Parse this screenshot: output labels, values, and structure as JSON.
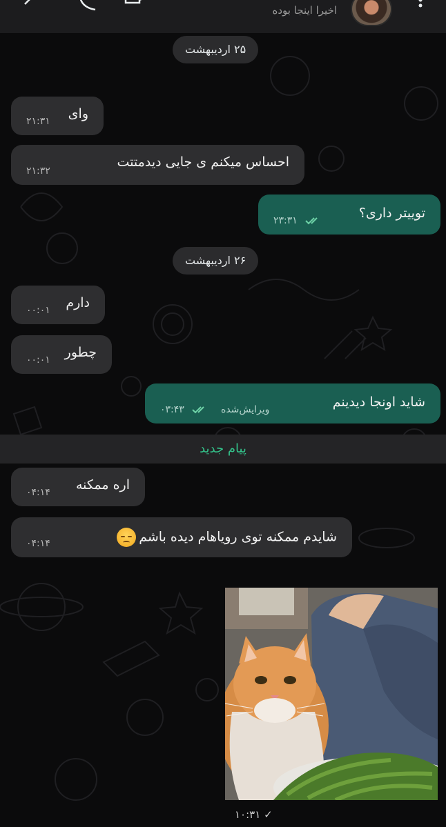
{
  "header": {
    "status": "اخیرا اینجا بوده"
  },
  "dates": [
    {
      "label": "۲۵ اردیبهشت"
    },
    {
      "label": "۲۶ اردیبهشت"
    }
  ],
  "messages": [
    {
      "text": "وای",
      "time": "۲۱:۳۱"
    },
    {
      "text": "احساس میکنم ی جایی دیدمتتت",
      "time": "۲۱:۳۲"
    },
    {
      "text": "توییتر داری؟",
      "time": "۲۳:۳۱"
    },
    {
      "text": "دارم",
      "time": "۰۰:۰۱"
    },
    {
      "text": "چطور",
      "time": "۰۰:۰۱"
    },
    {
      "text": "شاید اونجا دیدینم",
      "time": "۰۳:۴۳",
      "edited": "ویرایش‌شده"
    },
    {
      "text": "اره ممکنه",
      "time": "۰۴:۱۴"
    },
    {
      "text": "شایدم ممکنه توی رویاهام دیده باشم",
      "time": "۰۴:۱۴",
      "emoji": "pensive-face"
    },
    {
      "time": "۱۰:۳۱"
    }
  ],
  "new_messages_label": "پیام جدید",
  "colors": {
    "incoming": "#2e2e30",
    "outgoing": "#1a5f52",
    "accent": "#33c28a",
    "background": "#0b0b0c"
  }
}
